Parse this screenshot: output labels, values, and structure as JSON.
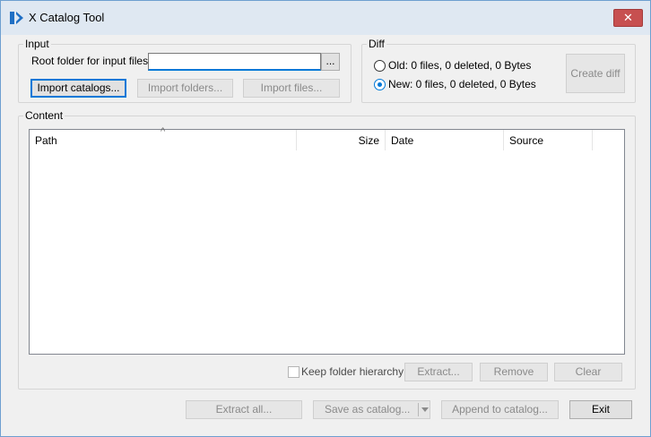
{
  "window": {
    "title": "X Catalog Tool",
    "close_glyph": "✕"
  },
  "input": {
    "legend": "Input",
    "root_folder_label": "Root folder for input files:",
    "root_folder_value": "",
    "browse_label": "...",
    "import_catalogs": "Import catalogs...",
    "import_folders": "Import folders...",
    "import_files": "Import files..."
  },
  "diff": {
    "legend": "Diff",
    "old_label": "Old: 0 files, 0 deleted, 0 Bytes",
    "new_label": "New: 0 files, 0 deleted, 0 Bytes",
    "selected": "new",
    "create_diff": "Create diff"
  },
  "content": {
    "legend": "Content",
    "columns": [
      "Path",
      "Size",
      "Date",
      "Source"
    ],
    "sort_indicator": "^",
    "rows": [],
    "keep_hierarchy_label": "Keep folder hierarchy",
    "keep_hierarchy_checked": false,
    "extract": "Extract...",
    "remove": "Remove",
    "clear": "Clear"
  },
  "footer": {
    "extract_all": "Extract all...",
    "save_as_catalog": "Save as catalog...",
    "append_to_catalog": "Append to catalog...",
    "exit": "Exit"
  },
  "colors": {
    "accent": "#0078d7",
    "close": "#c75050",
    "titlebar": "#dfe8f2"
  }
}
